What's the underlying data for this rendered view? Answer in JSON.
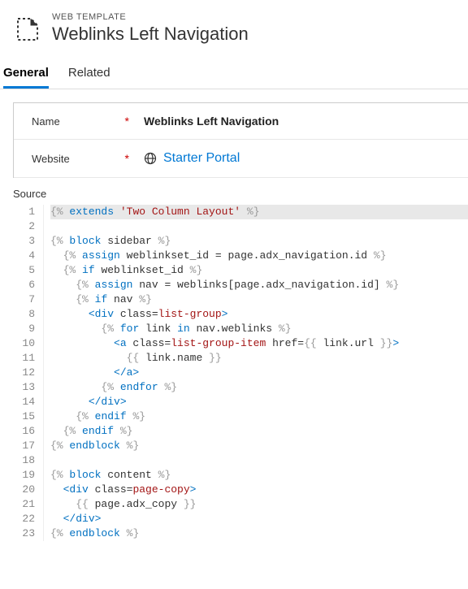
{
  "header": {
    "breadcrumb": "WEB TEMPLATE",
    "title": "Weblinks Left Navigation"
  },
  "tabs": {
    "general": "General",
    "related": "Related"
  },
  "form": {
    "name_label": "Name",
    "name_value": "Weblinks Left Navigation",
    "website_label": "Website",
    "website_value": "Starter Portal",
    "source_label": "Source"
  },
  "code": {
    "lines": [
      "{% extends 'Two Column Layout' %}",
      "",
      "{% block sidebar %}",
      "  {% assign weblinkset_id = page.adx_navigation.id %}",
      "  {% if weblinkset_id %}",
      "    {% assign nav = weblinks[page.adx_navigation.id] %}",
      "    {% if nav %}",
      "      <div class=list-group>",
      "        {% for link in nav.weblinks %}",
      "          <a class=list-group-item href={{ link.url }}>",
      "            {{ link.name }}",
      "          </a>",
      "        {% endfor %}",
      "      </div>",
      "    {% endif %}",
      "  {% endif %}",
      "{% endblock %}",
      "",
      "{% block content %}",
      "  <div class=page-copy>",
      "    {{ page.adx_copy }}",
      "  </div>",
      "{% endblock %}"
    ]
  }
}
